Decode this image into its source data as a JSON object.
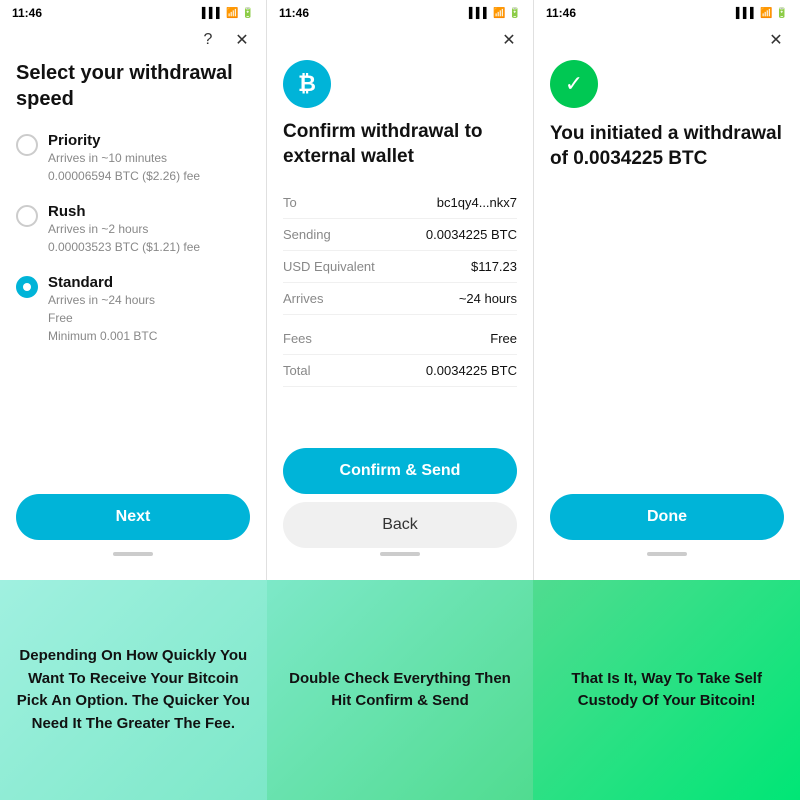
{
  "screens": [
    {
      "statusTime": "11:46",
      "title": "Select your withdrawal speed",
      "options": [
        {
          "id": "priority",
          "label": "Priority",
          "desc": "Arrives in ~10 minutes\n0.00006594 BTC ($2.26) fee",
          "selected": false
        },
        {
          "id": "rush",
          "label": "Rush",
          "desc": "Arrives in ~2 hours\n0.00003523 BTC ($1.21) fee",
          "selected": false
        },
        {
          "id": "standard",
          "label": "Standard",
          "desc": "Arrives in ~24 hours\nFree\nMinimum 0.001 BTC",
          "selected": true
        }
      ],
      "nextButton": "Next",
      "hasHelp": true,
      "hasClose": true
    },
    {
      "statusTime": "11:46",
      "title": "Confirm withdrawal to external wallet",
      "details": [
        {
          "label": "To",
          "value": "bc1qy4...nkx7"
        },
        {
          "label": "Sending",
          "value": "0.0034225 BTC"
        },
        {
          "label": "USD Equivalent",
          "value": "$117.23"
        },
        {
          "label": "Arrives",
          "value": "~24 hours"
        }
      ],
      "fees": [
        {
          "label": "Fees",
          "value": "Free"
        },
        {
          "label": "Total",
          "value": "0.0034225 BTC"
        }
      ],
      "confirmButton": "Confirm & Send",
      "backButton": "Back",
      "hasClose": true
    },
    {
      "statusTime": "11:46",
      "title": "You initiated a withdrawal of 0.0034225 BTC",
      "doneButton": "Done",
      "hasClose": true
    }
  ],
  "captions": [
    "Depending On How Quickly You Want To Receive Your Bitcoin Pick An Option. The Quicker You Need It The Greater The Fee.",
    "Double Check Everything Then Hit Confirm & Send",
    "That Is It, Way To Take Self Custody Of Your Bitcoin!"
  ]
}
